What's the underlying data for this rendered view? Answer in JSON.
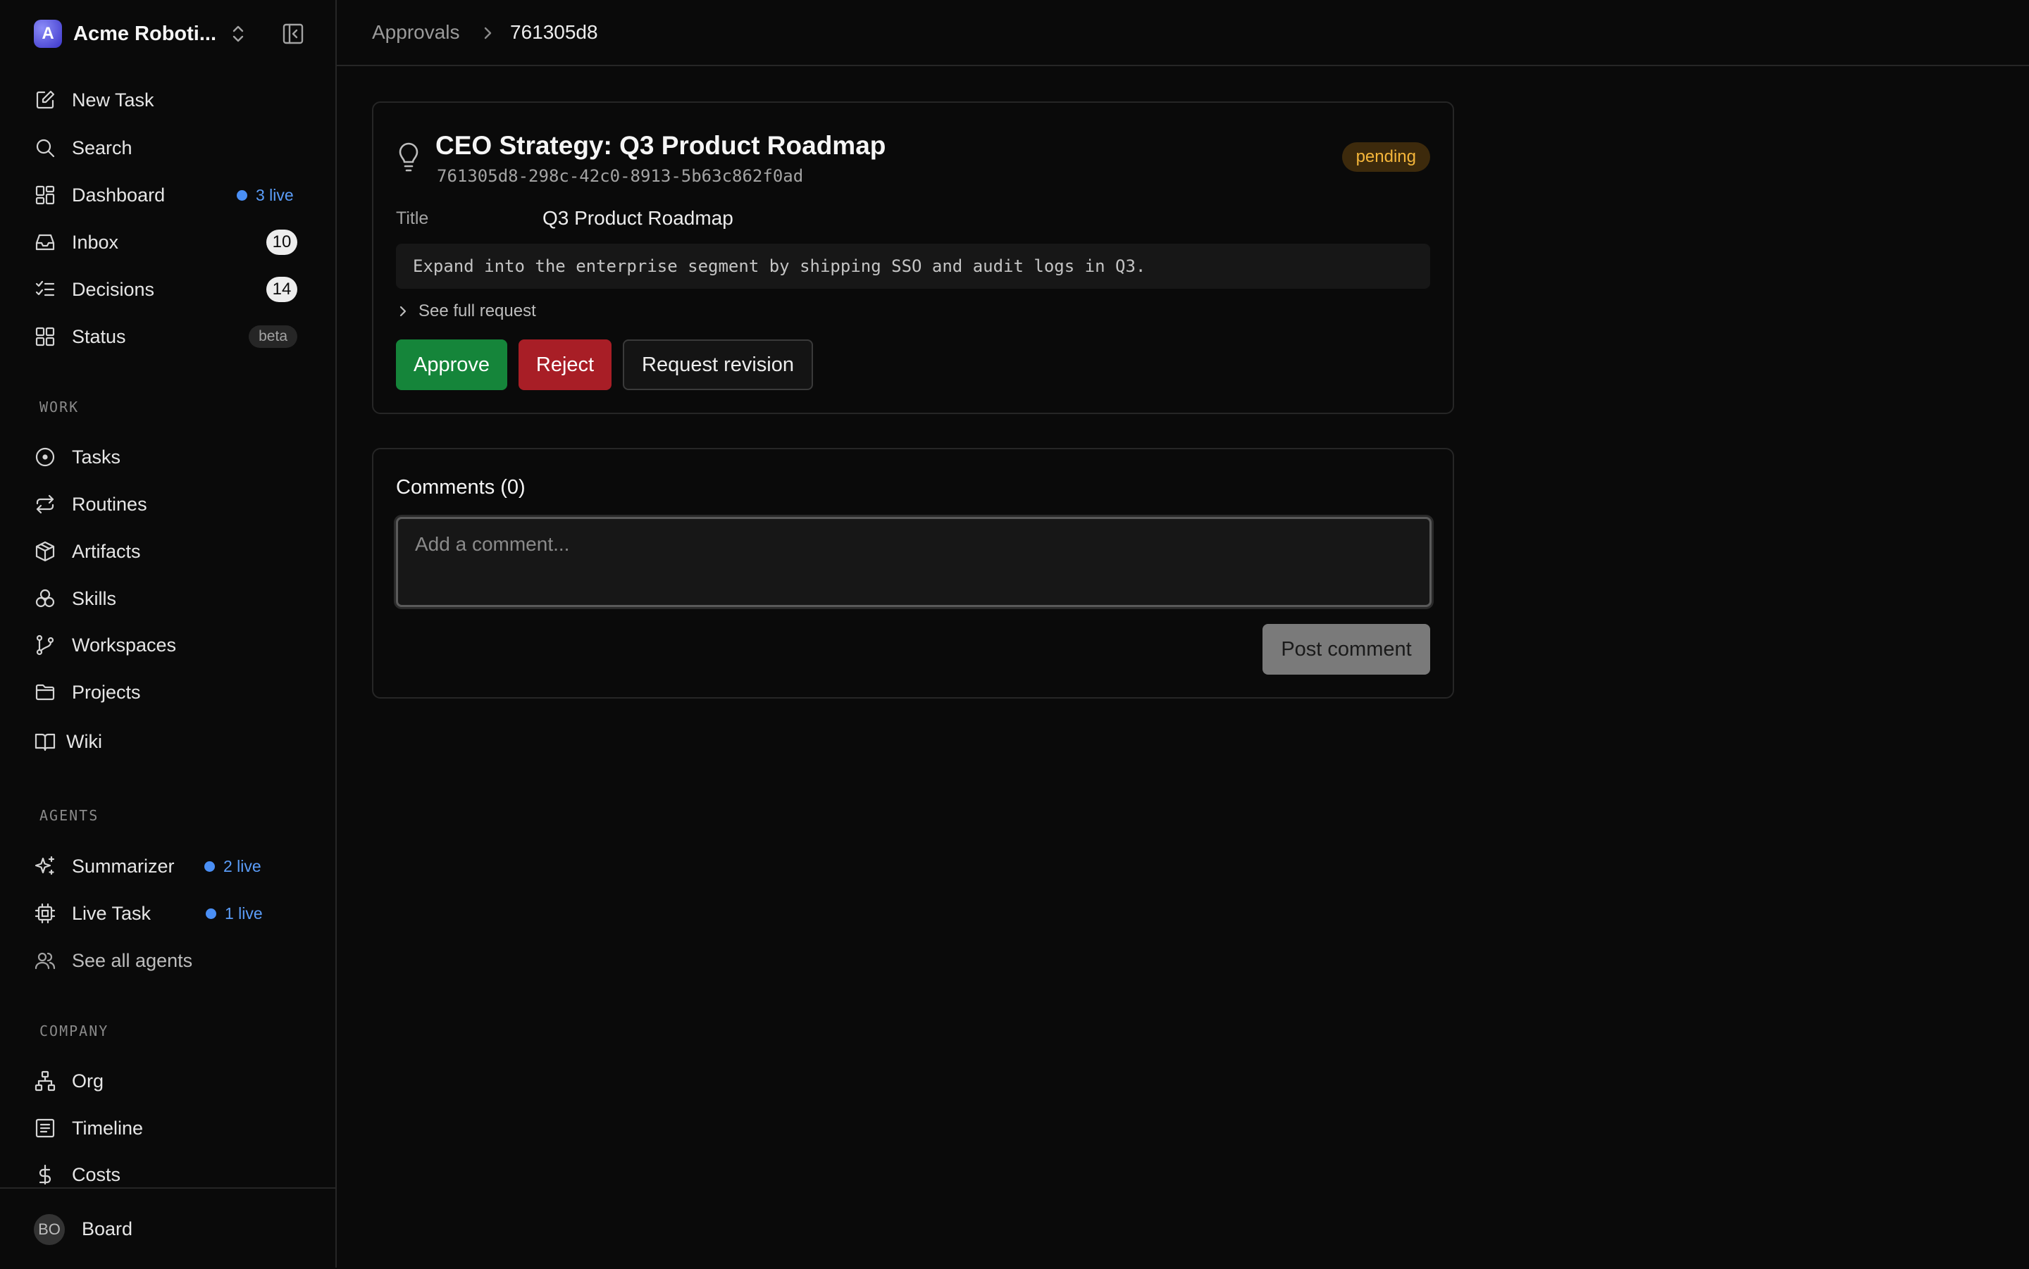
{
  "workspace": {
    "initial": "A",
    "name": "Acme Roboti..."
  },
  "nav": {
    "new_task": "New Task",
    "search": "Search",
    "dashboard": "Dashboard",
    "dashboard_live": "3 live",
    "inbox": "Inbox",
    "inbox_count": "10",
    "decisions": "Decisions",
    "decisions_count": "14",
    "status": "Status",
    "status_badge": "beta"
  },
  "sections": {
    "work": {
      "label": "WORK",
      "items": [
        "Tasks",
        "Routines",
        "Artifacts",
        "Skills",
        "Workspaces",
        "Projects",
        "Wiki"
      ]
    },
    "agents": {
      "label": "AGENTS",
      "items": [
        {
          "label": "Summarizer",
          "live": "2 live"
        },
        {
          "label": "Live Task",
          "live": "1 live"
        },
        {
          "label": "See all agents"
        }
      ]
    },
    "company": {
      "label": "COMPANY",
      "items": [
        "Org",
        "Timeline",
        "Costs"
      ]
    }
  },
  "footer": {
    "avatar": "BO",
    "name": "Board"
  },
  "breadcrumb": {
    "parent": "Approvals",
    "current": "761305d8"
  },
  "approval": {
    "title": "CEO Strategy: Q3 Product Roadmap",
    "id": "761305d8-298c-42c0-8913-5b63c862f0ad",
    "status": "pending",
    "field_label": "Title",
    "field_value": "Q3 Product Roadmap",
    "summary": "Expand into the enterprise segment by shipping SSO and audit logs in Q3.",
    "see_full": "See full request",
    "approve": "Approve",
    "reject": "Reject",
    "revise": "Request revision"
  },
  "comments": {
    "title": "Comments (0)",
    "placeholder": "Add a comment...",
    "post": "Post comment"
  },
  "colors": {
    "approve": "#15853a",
    "reject": "#a81e26",
    "pending_text": "#f5b63a",
    "live": "#4a8ff5"
  }
}
